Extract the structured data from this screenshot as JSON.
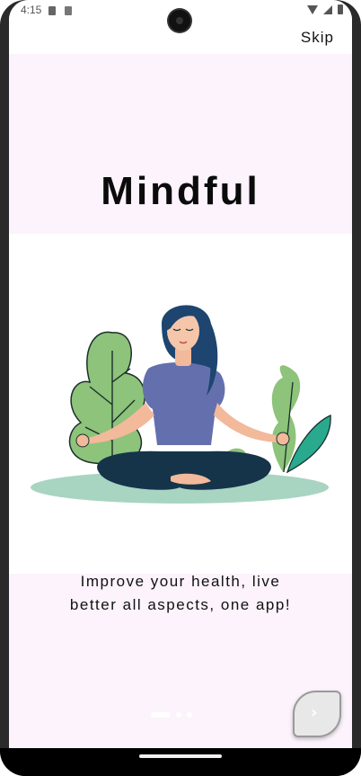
{
  "status": {
    "time": "4:15"
  },
  "header": {
    "skip_label": "Skip"
  },
  "main": {
    "title": "Mindful",
    "subtitle_line1": "Improve your health, live",
    "subtitle_line2": "better all aspects, one app!"
  },
  "pager": {
    "pages": 3,
    "current": 1
  },
  "next": {
    "icon": "chevron-right-icon",
    "glyph": "›"
  },
  "colors": {
    "band": "#fcf3fc",
    "leaf_green": "#8dc37a",
    "teal": "#29a98d",
    "shirt": "#6470ad",
    "hair": "#1d4570",
    "pants": "#15344a",
    "mat": "#a8d4c2"
  }
}
